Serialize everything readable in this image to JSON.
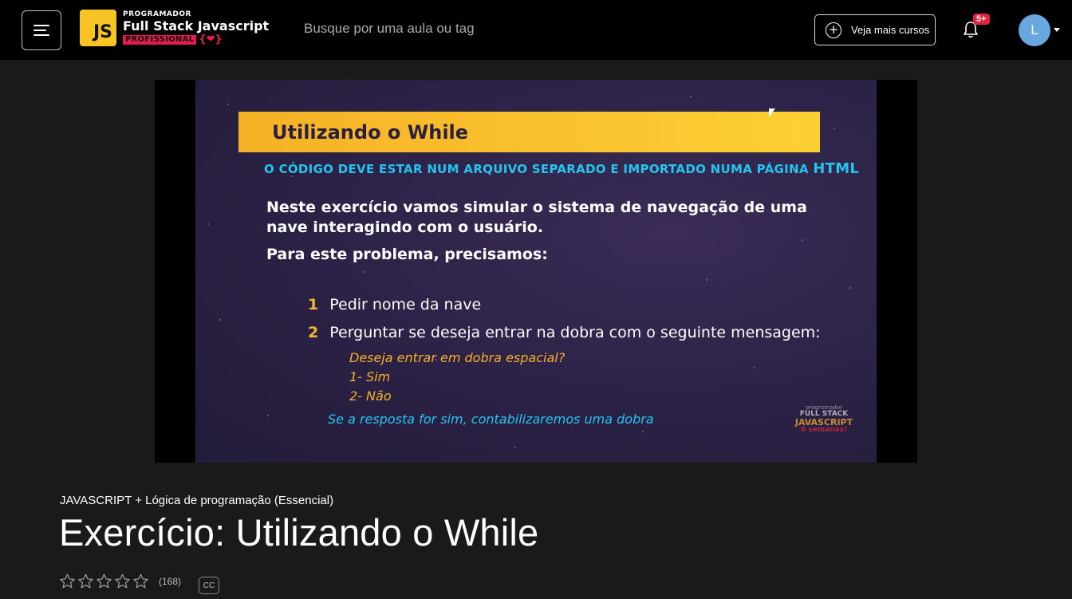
{
  "header": {
    "menu_icon": "hamburger-icon",
    "logo": {
      "badge": "JS",
      "small": "PROGRAMADOR",
      "big": "Full Stack Javascript",
      "pro": "PROFISSIONAL",
      "brace": "{❤}"
    },
    "search": {
      "placeholder": "Busque por uma aula ou tag",
      "value": ""
    },
    "more_courses_label": "Veja mais cursos",
    "notifications_badge": "5+",
    "avatar_letter": "L"
  },
  "video": {
    "slide_title": "Utilizando o While",
    "subtitle_main": "O CÓDIGO DEVE ESTAR NUM ARQUIVO SEPARADO E IMPORTADO NUMA PÁGINA",
    "subtitle_html": "HTML",
    "paragraph1": "Neste exercício vamos simular o sistema de navegação de uma nave interagindo com o usuário.",
    "paragraph2": "Para este problema, precisamos:",
    "items": [
      {
        "num": "1",
        "text": "Pedir nome da nave"
      },
      {
        "num": "2",
        "text": "Perguntar se deseja entrar na dobra com o seguinte mensagem:"
      }
    ],
    "question_lines": [
      "Deseja entrar em dobra espacial?",
      "1- Sim",
      "2- Não"
    ],
    "note": "Se a resposta for sim, contabilizaremos uma dobra",
    "watermark": {
      "line1": "programador",
      "line2": "FULL STACK",
      "line3": "JAVASCRIPT",
      "line4": "8 semanas!"
    }
  },
  "lesson": {
    "course": "JAVASCRIPT + Lógica de programação (Essencial)",
    "title": "Exercício: Utilizando o While",
    "rating_count": "(168)",
    "stars_filled": 0,
    "cc_label": "CC"
  },
  "colors": {
    "accent_yellow": "#f7c325",
    "accent_red": "#e11d48",
    "accent_cyan": "#22c6f0",
    "avatar_blue": "#6aa6df"
  }
}
